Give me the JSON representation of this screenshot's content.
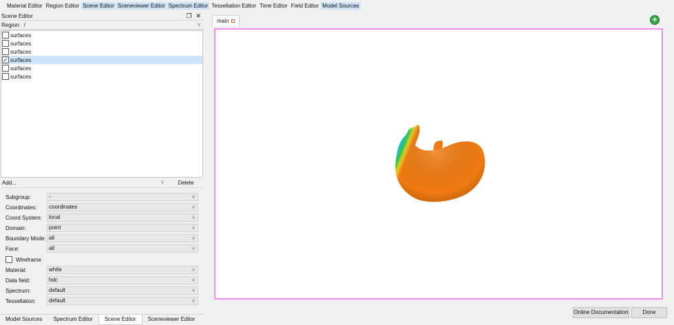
{
  "menu": [
    {
      "label": "Material Editor",
      "highlighted": false
    },
    {
      "label": "Region Editor",
      "highlighted": false
    },
    {
      "label": "Scene Editor",
      "highlighted": true
    },
    {
      "label": "Sceneviewer Editor",
      "highlighted": true
    },
    {
      "label": "Spectrum Editor",
      "highlighted": true
    },
    {
      "label": "Tessellation Editor",
      "highlighted": false
    },
    {
      "label": "Time Editor",
      "highlighted": false
    },
    {
      "label": "Field Editor",
      "highlighted": false
    },
    {
      "label": "Model Sources",
      "highlighted": true
    }
  ],
  "scene_editor": {
    "title": "Scene Editor",
    "float_icon": "float-icon",
    "close_icon": "close-icon",
    "region_label": "Region:",
    "region_value": "/",
    "items": [
      {
        "label": "surfaces",
        "checked": false,
        "selected": false
      },
      {
        "label": "surfaces",
        "checked": false,
        "selected": false
      },
      {
        "label": "surfaces",
        "checked": false,
        "selected": false
      },
      {
        "label": "surfaces",
        "checked": true,
        "selected": true
      },
      {
        "label": "surfaces",
        "checked": false,
        "selected": false
      },
      {
        "label": "surfaces",
        "checked": false,
        "selected": false
      }
    ],
    "add_label": "Add...",
    "delete_label": "Delete",
    "props": {
      "subgroup": {
        "label": "Subgroup:",
        "value": "-"
      },
      "coordinates": {
        "label": "Coordinates:",
        "value": "coordinates"
      },
      "coord_system": {
        "label": "Coord System:",
        "value": "local"
      },
      "domain": {
        "label": "Domain:",
        "value": "point"
      },
      "boundary_mode": {
        "label": "Boundary Mode:",
        "value": "all"
      },
      "face": {
        "label": "Face:",
        "value": "all"
      },
      "wireframe": {
        "label": "Wireframe",
        "checked": false
      },
      "material": {
        "label": "Material:",
        "value": "white"
      },
      "data_field": {
        "label": "Data field:",
        "value": "hdc"
      },
      "spectrum": {
        "label": "Spectrum:",
        "value": "default"
      },
      "tessellation": {
        "label": "Tessellation:",
        "value": "default"
      }
    }
  },
  "bottom_tabs": [
    {
      "label": "Model Sources",
      "active": false
    },
    {
      "label": "Spectrum Editor",
      "active": false
    },
    {
      "label": "Scene Editor",
      "active": true
    },
    {
      "label": "Sceneviewer Editor",
      "active": false
    }
  ],
  "viewer": {
    "tab_label": "main",
    "add_icon": "plus-icon",
    "add_symbol": "+"
  },
  "footer": {
    "online_doc_label": "Online Documentation",
    "done_label": "Done"
  },
  "colors": {
    "highlight": "#cfe3f7",
    "viewport_border": "#f08cf0",
    "model_orange": "#ef7a10",
    "model_blue": "#1434c8"
  }
}
